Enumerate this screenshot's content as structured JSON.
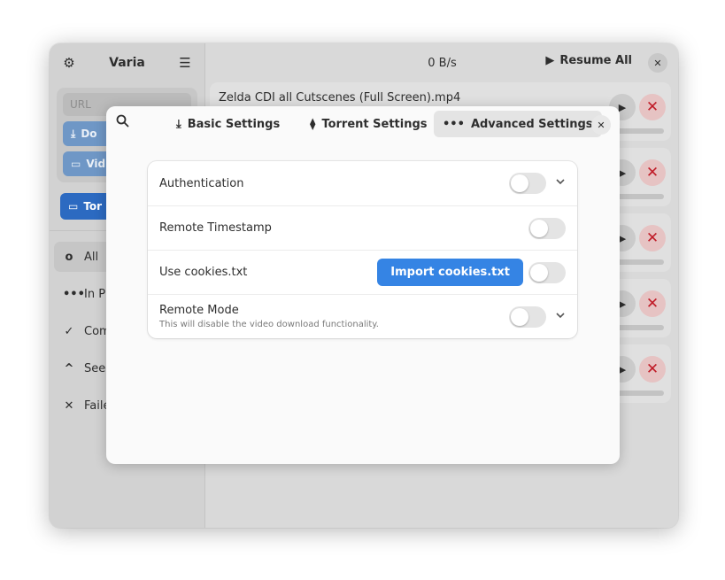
{
  "sidebar": {
    "title": "Varia",
    "settings_icon": "gear-icon",
    "menu_icon": "hamburger-menu-icon",
    "url_placeholder": "URL",
    "download_button": "Do",
    "video_button": "Vid",
    "torrent_button": "Tor",
    "filters": [
      {
        "label": "All",
        "icon": "circle-icon"
      },
      {
        "label": "In Pr",
        "icon": "dots-icon"
      },
      {
        "label": "Com",
        "icon": "check-icon"
      },
      {
        "label": "Seed",
        "icon": "chevron-up-icon"
      },
      {
        "label": "Faile",
        "icon": "x-icon"
      }
    ]
  },
  "header": {
    "speed": "0 B/s",
    "resume_all": "Resume All"
  },
  "downloads": [
    {
      "name": "Zelda CDI all Cutscenes (Full Screen).mp4"
    },
    {
      "name": ""
    },
    {
      "name": ""
    },
    {
      "name": ""
    },
    {
      "name": ""
    }
  ],
  "dialog": {
    "tabs": [
      {
        "label": "Basic Settings",
        "icon": "download-icon"
      },
      {
        "label": "Torrent Settings",
        "icon": "torrent-icon"
      },
      {
        "label": "Advanced Settings",
        "icon": "more-dots-icon"
      }
    ],
    "selected_tab": "Advanced Settings",
    "rows": {
      "authentication": {
        "label": "Authentication",
        "enabled": false
      },
      "remote_timestamp": {
        "label": "Remote Timestamp",
        "enabled": false
      },
      "cookies": {
        "label": "Use cookies.txt",
        "button": "Import cookies.txt",
        "enabled": false
      },
      "remote_mode": {
        "label": "Remote Mode",
        "subtitle": "This will disable the video download functionality.",
        "enabled": false
      }
    }
  },
  "colors": {
    "accent": "#3584e4",
    "destructive": "#c01c28"
  }
}
